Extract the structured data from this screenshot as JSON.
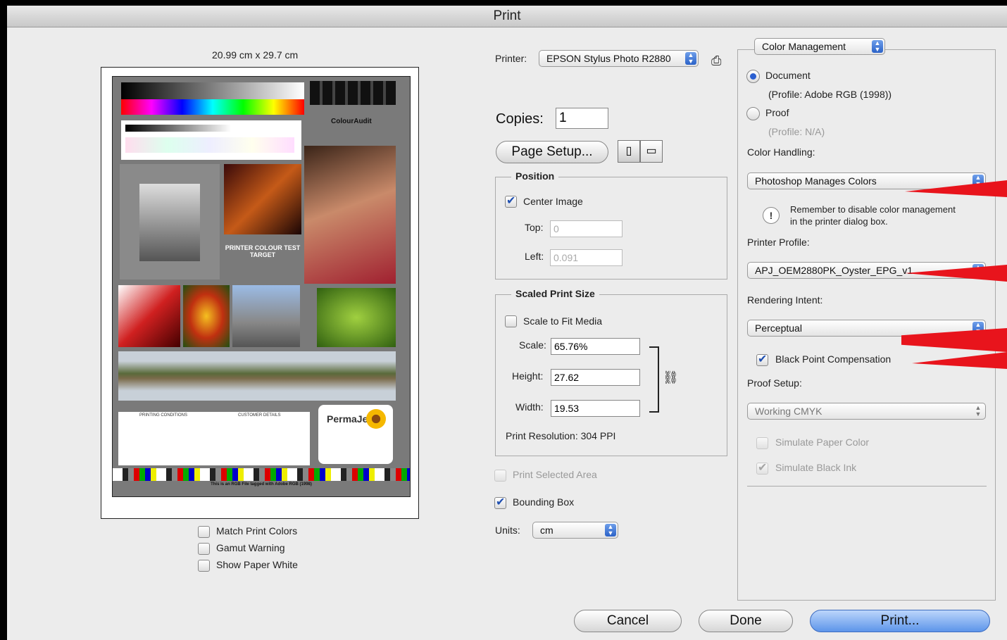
{
  "window": {
    "title": "Print"
  },
  "preview": {
    "size_label": "20.99 cm x 29.7 cm",
    "logo_text": "ColourAudit",
    "target_text": "PRINTER COLOUR TEST TARGET",
    "permajet_text": "PermaJet",
    "footer_text": "This is an RGB File tagged with Adobe RGB (1998)",
    "conditions_header": "PRINTING CONDITIONS",
    "customer_header": "CUSTOMER DETAILS"
  },
  "preview_options": [
    {
      "label": "Match Print Colors",
      "checked": false
    },
    {
      "label": "Gamut Warning",
      "checked": false
    },
    {
      "label": "Show Paper White",
      "checked": false
    }
  ],
  "printer": {
    "label": "Printer:",
    "value": "EPSON Stylus Photo R2880"
  },
  "copies": {
    "label": "Copies:",
    "value": "1"
  },
  "page_setup_label": "Page Setup...",
  "position": {
    "title": "Position",
    "center_image": {
      "label": "Center Image",
      "checked": true
    },
    "top": {
      "label": "Top:",
      "value": "0"
    },
    "left": {
      "label": "Left:",
      "value": "0.091"
    }
  },
  "scaled": {
    "title": "Scaled Print Size",
    "scale_to_fit": {
      "label": "Scale to Fit Media",
      "checked": false
    },
    "scale": {
      "label": "Scale:",
      "value": "65.76%"
    },
    "height": {
      "label": "Height:",
      "value": "27.62"
    },
    "width": {
      "label": "Width:",
      "value": "19.53"
    },
    "resolution": "Print Resolution: 304 PPI"
  },
  "print_selected_area": {
    "label": "Print Selected Area",
    "checked": false
  },
  "bounding_box": {
    "label": "Bounding Box",
    "checked": true
  },
  "units": {
    "label": "Units:",
    "value": "cm"
  },
  "color_mgmt": {
    "menu_value": "Color Management",
    "document": {
      "label": "Document",
      "profile": "(Profile: Adobe RGB (1998))",
      "selected": true
    },
    "proof": {
      "label": "Proof",
      "profile": "(Profile: N/A)",
      "selected": false
    },
    "color_handling_label": "Color Handling:",
    "color_handling_value": "Photoshop Manages Colors",
    "notice_line1": "Remember to disable color management",
    "notice_line2": "in the printer dialog box.",
    "printer_profile_label": "Printer Profile:",
    "printer_profile_value": "APJ_OEM2880PK_Oyster_EPG_v1",
    "rendering_intent_label": "Rendering Intent:",
    "rendering_intent_value": "Perceptual",
    "bpc": {
      "label": "Black Point Compensation",
      "checked": true
    },
    "proof_setup_label": "Proof Setup:",
    "proof_setup_value": "Working CMYK",
    "simulate_paper": {
      "label": "Simulate Paper Color",
      "checked": false
    },
    "simulate_ink": {
      "label": "Simulate Black Ink",
      "checked": true
    }
  },
  "buttons": {
    "cancel": "Cancel",
    "done": "Done",
    "print": "Print..."
  },
  "colors": {
    "accent": "#2b62c8",
    "arrow": "#e8141c",
    "print_button": "#5d95ea"
  }
}
